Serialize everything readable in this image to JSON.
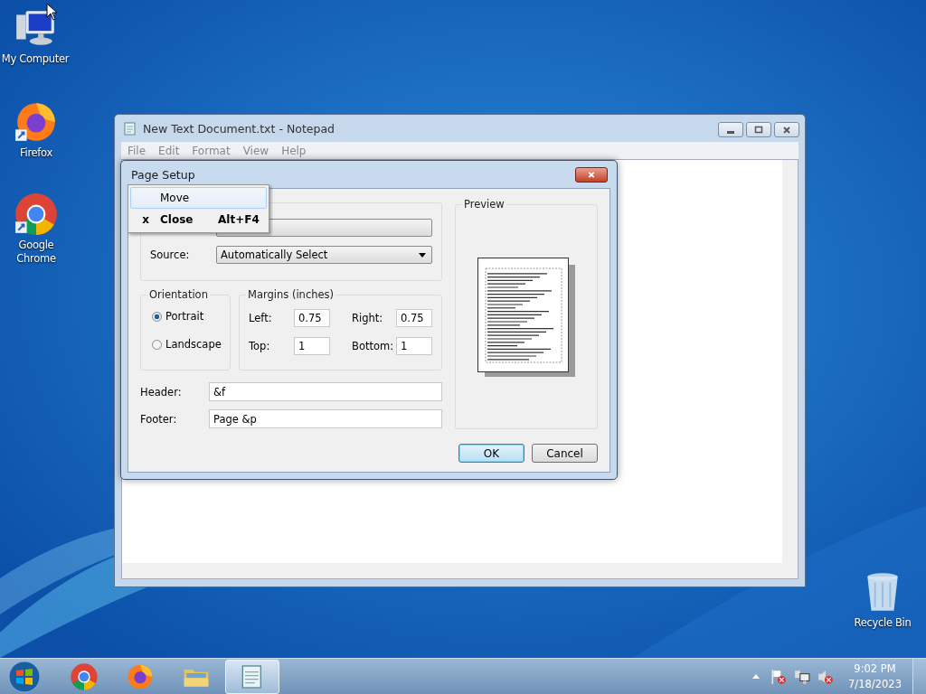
{
  "desktop_icons": [
    {
      "kind": "computer",
      "label": "My Computer"
    },
    {
      "kind": "firefox",
      "label": "Firefox"
    },
    {
      "kind": "chrome",
      "label": "Google Chrome"
    },
    {
      "kind": "bin",
      "label": "Recycle Bin"
    }
  ],
  "notepad": {
    "title": "New Text Document.txt - Notepad",
    "menu": [
      "File",
      "Edit",
      "Format",
      "View",
      "Help"
    ]
  },
  "dialog": {
    "title": "Page Setup",
    "source_label": "Source:",
    "source_value": "Automatically Select",
    "orientation": {
      "label": "Orientation",
      "options": [
        {
          "label": "Portrait",
          "selected": true
        },
        {
          "label": "Landscape",
          "selected": false
        }
      ]
    },
    "margins": {
      "label": "Margins (inches)",
      "fields": [
        {
          "label": "Left:",
          "value": "0.75"
        },
        {
          "label": "Right:",
          "value": "0.75"
        },
        {
          "label": "Top:",
          "value": "1"
        },
        {
          "label": "Bottom:",
          "value": "1"
        }
      ]
    },
    "header": {
      "label": "Header:",
      "value": "&f"
    },
    "footer": {
      "label": "Footer:",
      "value": "Page &p"
    },
    "preview_label": "Preview",
    "buttons": [
      {
        "label": "OK",
        "selected": true
      },
      {
        "label": "Cancel",
        "selected": false
      }
    ]
  },
  "system_menu": [
    {
      "label": "Move",
      "selected": true,
      "default": false
    },
    {
      "mark": "x",
      "label": "Close",
      "shortcut": "Alt+F4",
      "selected": false,
      "default": true
    }
  ],
  "taskbar": {
    "apps": [
      {
        "kind": "chrome",
        "selected": false
      },
      {
        "kind": "firefox",
        "selected": false
      },
      {
        "kind": "explorer",
        "selected": false
      },
      {
        "kind": "notepad",
        "selected": true
      }
    ]
  },
  "clock": {
    "time": "9:02 PM",
    "date": "7/18/2023"
  }
}
